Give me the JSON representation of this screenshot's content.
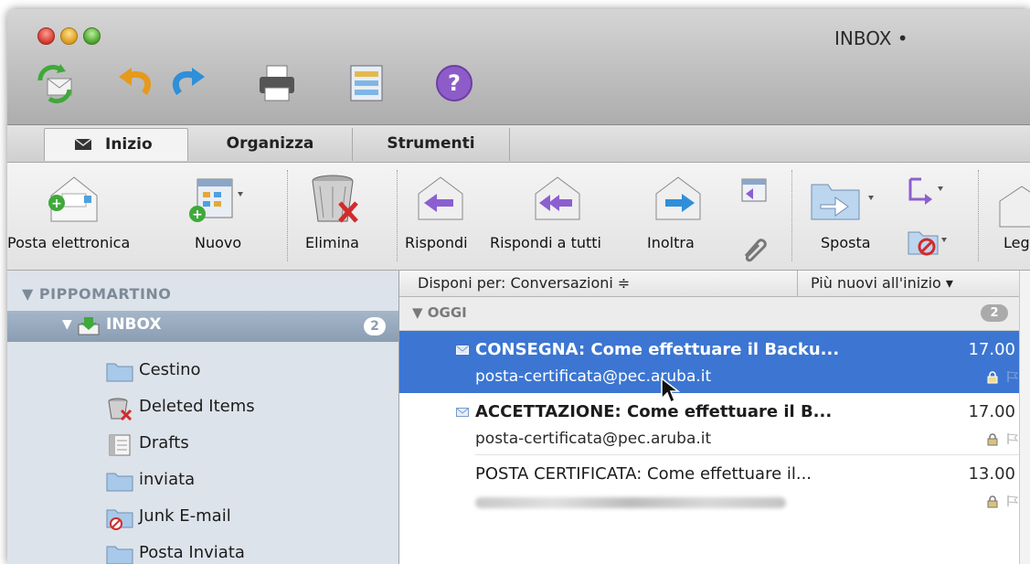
{
  "window": {
    "title": "INBOX •"
  },
  "toolbar": {
    "icons": [
      "sync-icon",
      "undo-icon",
      "redo-icon",
      "print-icon",
      "layout-icon",
      "help-icon"
    ]
  },
  "tabs": [
    {
      "label": "Inizio",
      "active": true
    },
    {
      "label": "Organizza",
      "active": false
    },
    {
      "label": "Strumenti",
      "active": false
    }
  ],
  "ribbon": {
    "posta_elettronica": "Posta elettronica",
    "nuovo": "Nuovo",
    "elimina": "Elimina",
    "rispondi": "Rispondi",
    "rispondi_a_tutti": "Rispondi a tutti",
    "inoltra": "Inoltra",
    "sposta": "Sposta",
    "leggi_partial": "Leg"
  },
  "sidebar": {
    "account": "PIPPOMARTINO",
    "inbox_label": "INBOX",
    "inbox_count": "2",
    "folders": [
      {
        "label": "Cestino",
        "icon": "folder-icon"
      },
      {
        "label": "Deleted Items",
        "icon": "trash-folder-icon"
      },
      {
        "label": "Drafts",
        "icon": "drafts-icon"
      },
      {
        "label": "inviata",
        "icon": "folder-icon"
      },
      {
        "label": "Junk E-mail",
        "icon": "junk-folder-icon"
      },
      {
        "label": "Posta Inviata",
        "icon": "folder-icon"
      }
    ]
  },
  "list": {
    "arrange_by": "Disponi per: Conversazioni ≑",
    "sort_order": "Più nuovi all'inizio ▾",
    "group": {
      "label": "OGGI",
      "count": "2"
    },
    "messages": [
      {
        "subject": "CONSEGNA: Come effettuare il Backu...",
        "from": "posta-certificata@pec.aruba.it",
        "time": "17.00",
        "selected": true,
        "unread": true
      },
      {
        "subject": "ACCETTAZIONE: Come effettuare il B...",
        "from": "posta-certificata@pec.aruba.it",
        "time": "17.00",
        "selected": false,
        "unread": true
      },
      {
        "subject": "POSTA CERTIFICATA: Come effettuare il...",
        "from": "",
        "time": "13.00",
        "selected": false,
        "unread": false
      }
    ]
  },
  "colors": {
    "selection": "#3c76d2",
    "sidebar": "#dde3ea",
    "inbox_highlight": "#8a9db3"
  }
}
